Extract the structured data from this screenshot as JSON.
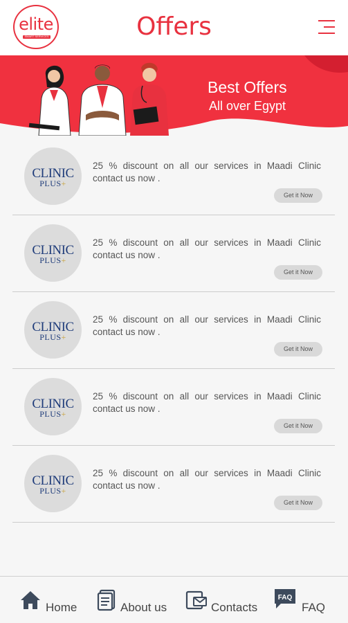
{
  "header": {
    "logo_text": "elite",
    "logo_tagline": "SMART SERVICES",
    "title": "Offers",
    "menu_icon": "hamburger-icon"
  },
  "banner": {
    "title": "Best Offers",
    "subtitle": "All over Egypt",
    "bg_color": "#f0313f"
  },
  "offers": [
    {
      "logo_top": "CLINIC",
      "logo_bottom": "PLUS",
      "logo_plus": "+",
      "text": "25 % discount on all our services in Maadi Clinic contact us now .",
      "button": "Get it Now"
    },
    {
      "logo_top": "CLINIC",
      "logo_bottom": "PLUS",
      "logo_plus": "+",
      "text": "25 % discount on all our services in Maadi Clinic contact us now .",
      "button": "Get it Now"
    },
    {
      "logo_top": "CLINIC",
      "logo_bottom": "PLUS",
      "logo_plus": "+",
      "text": "25 % discount on all our services in Maadi Clinic contact us now .",
      "button": "Get it Now"
    },
    {
      "logo_top": "CLINIC",
      "logo_bottom": "PLUS",
      "logo_plus": "+",
      "text": "25 % discount on all our services in Maadi Clinic contact us now .",
      "button": "Get it Now"
    },
    {
      "logo_top": "CLINIC",
      "logo_bottom": "PLUS",
      "logo_plus": "+",
      "text": "25 % discount on all our services in Maadi Clinic contact us now .",
      "button": "Get it Now"
    }
  ],
  "bottom_nav": {
    "home": {
      "label": "Home",
      "icon": "home-icon"
    },
    "about": {
      "label": "About us",
      "icon": "document-icon"
    },
    "contacts": {
      "label": "Contacts",
      "icon": "contact-icon"
    },
    "faq": {
      "label": "FAQ",
      "icon": "faq-icon",
      "icon_text": "FAQ"
    }
  },
  "colors": {
    "accent": "#e8313f",
    "text": "#555555",
    "nav_icon": "#3d4a5c"
  }
}
